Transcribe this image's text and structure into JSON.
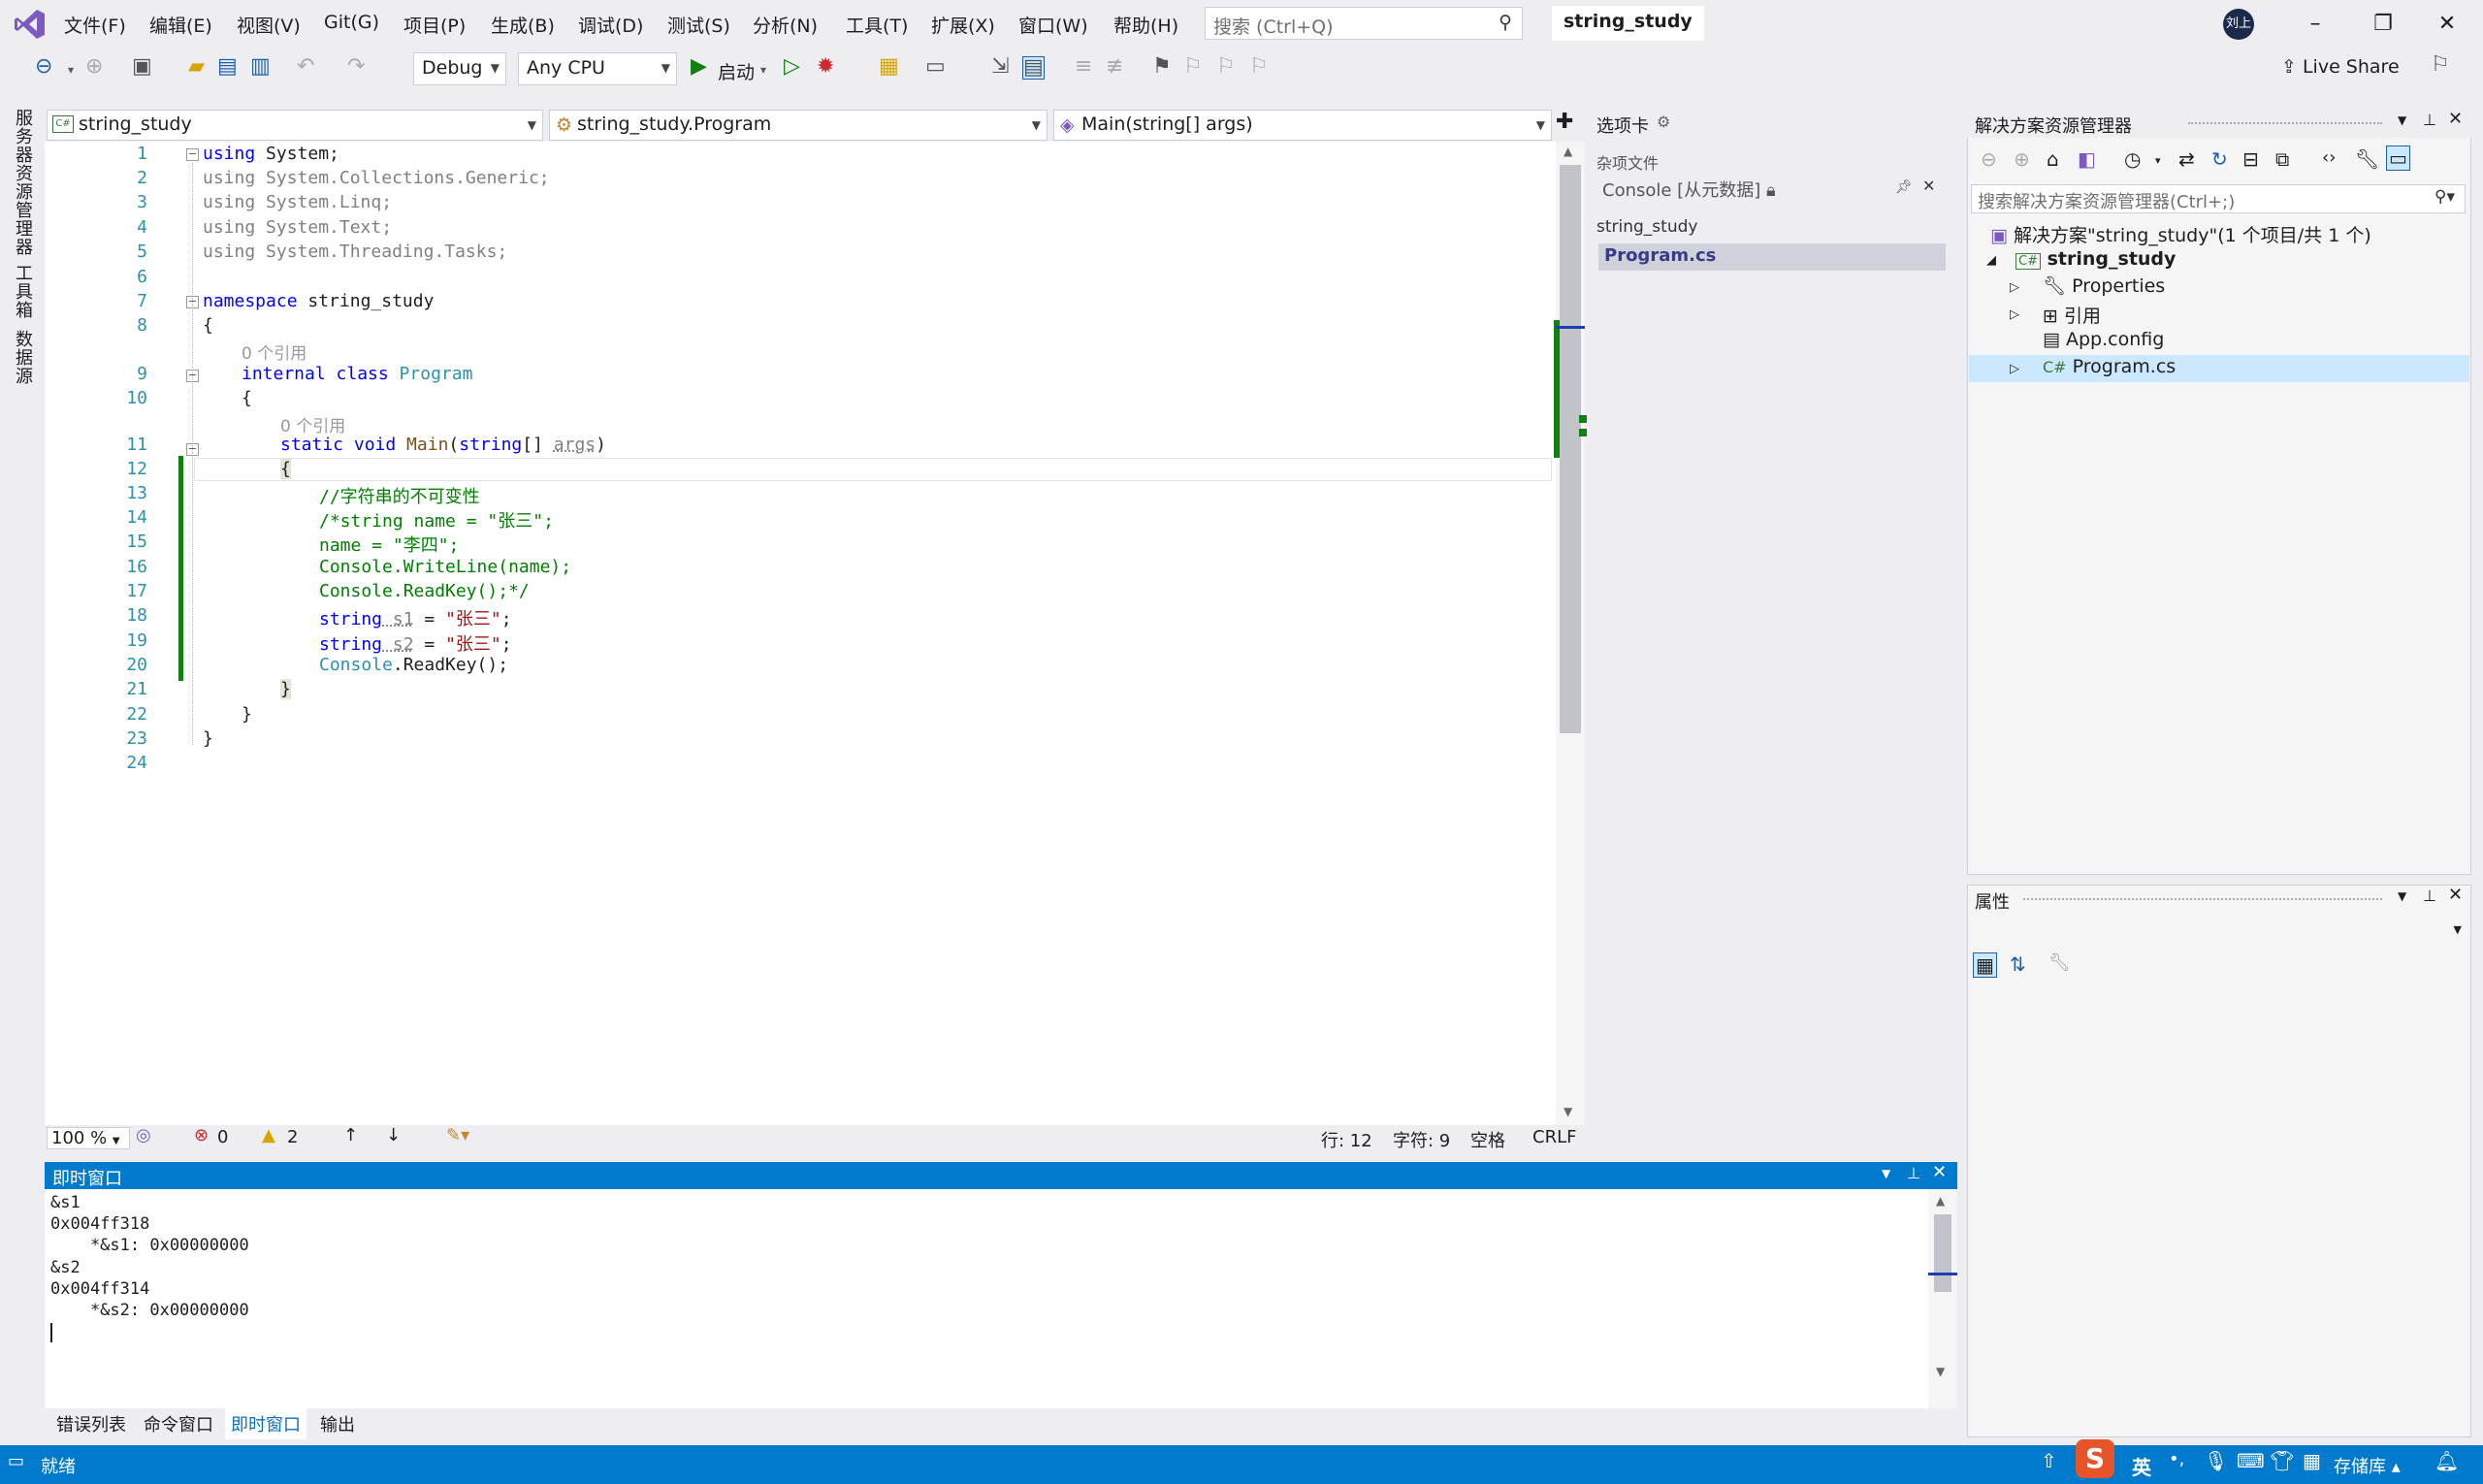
{
  "menu": {
    "items": [
      "文件(F)",
      "编辑(E)",
      "视图(V)",
      "Git(G)",
      "项目(P)",
      "生成(B)",
      "调试(D)",
      "测试(S)",
      "分析(N)",
      "工具(T)",
      "扩展(X)",
      "窗口(W)",
      "帮助(H)"
    ],
    "search_placeholder": "搜索 (Ctrl+Q)",
    "solution_title": "string_study",
    "avatar_text": "刘上"
  },
  "toolbar": {
    "config": "Debug",
    "platform": "Any CPU",
    "start_label": "启动",
    "live_share": "Live Share"
  },
  "left_tabs": [
    "服务器资源管理器",
    "工具箱",
    "数据源"
  ],
  "editor": {
    "nav_project": "string_study",
    "nav_class": "string_study.Program",
    "nav_member": "Main(string[] args)",
    "ref_hint_1": "0 个引用",
    "ref_hint_2": "0 个引用",
    "zoom": "100 %",
    "errors": "0",
    "warnings": "2",
    "line": "行: 12",
    "char": "字符: 9",
    "spaces": "空格",
    "eol": "CRLF",
    "code": {
      "l1_kw": "using",
      "l1_rest": " System;",
      "l2": "using System.Collections.Generic;",
      "l3": "using System.Linq;",
      "l4": "using System.Text;",
      "l5": "using System.Threading.Tasks;",
      "l7_kw": "namespace",
      "l7_rest": " string_study",
      "l8": "{",
      "l9_kw": "internal class",
      "l9_ty": " Program",
      "l10": "{",
      "l11_kw": "static void",
      "l11_m": " Main",
      "l11_p": "(",
      "l11_kw2": "string",
      "l11_r": "[] ",
      "l11_arg": "args",
      "l11_e": ")",
      "l12": "{",
      "l13": "//字符串的不可变性",
      "l14_a": "/*string name = ",
      "l14_s": "\"张三\"",
      "l14_e": ";",
      "l15_a": "name = ",
      "l15_s": "\"李四\"",
      "l15_e": ";",
      "l16_a": "Console",
      "l16_b": ".WriteLine(name);",
      "l17_a": "Console",
      "l17_b": ".ReadKey();*/",
      "l18_kw": "string",
      "l18_v": " s1",
      "l18_eq": " = ",
      "l18_s": "\"张三\"",
      "l18_e": ";",
      "l19_kw": "string",
      "l19_v": " s2",
      "l19_eq": " = ",
      "l19_s": "\"张三\"",
      "l19_e": ";",
      "l20_a": "Console",
      "l20_b": ".ReadKey();",
      "l21": "}",
      "l22": "}",
      "l23": "}"
    },
    "line_numbers": [
      "1",
      "2",
      "3",
      "4",
      "5",
      "6",
      "7",
      "8",
      "9",
      "10",
      "11",
      "12",
      "13",
      "14",
      "15",
      "16",
      "17",
      "18",
      "19",
      "20",
      "21",
      "22",
      "23",
      "24"
    ]
  },
  "tabs_panel": {
    "title": "选项卡",
    "misc_label": "杂项文件",
    "console_item": "Console [从元数据]",
    "project": "string_study",
    "file": "Program.cs"
  },
  "solution_explorer": {
    "title": "解决方案资源管理器",
    "search_placeholder": "搜索解决方案资源管理器(Ctrl+;)",
    "solution": "解决方案\"string_study\"(1 个项目/共 1 个)",
    "project": "string_study",
    "items": [
      "Properties",
      "引用",
      "App.config",
      "Program.cs"
    ]
  },
  "properties": {
    "title": "属性"
  },
  "immediate": {
    "title": "即时窗口",
    "lines": [
      "&s1",
      "0x004ff318",
      "    *&s1: 0x00000000",
      "&s2",
      "0x004ff314",
      "    *&s2: 0x00000000"
    ]
  },
  "bottom_tabs": [
    "错误列表",
    "命令窗口",
    "即时窗口",
    "输出"
  ],
  "status": {
    "ready": "就绪",
    "ime_lang": "英",
    "repo": "存储库"
  },
  "colors": {
    "accent": "#007acc",
    "changebar": "#108010",
    "keyword": "#0000ff",
    "type": "#2b91af",
    "string": "#a31515",
    "comment": "#008000"
  }
}
